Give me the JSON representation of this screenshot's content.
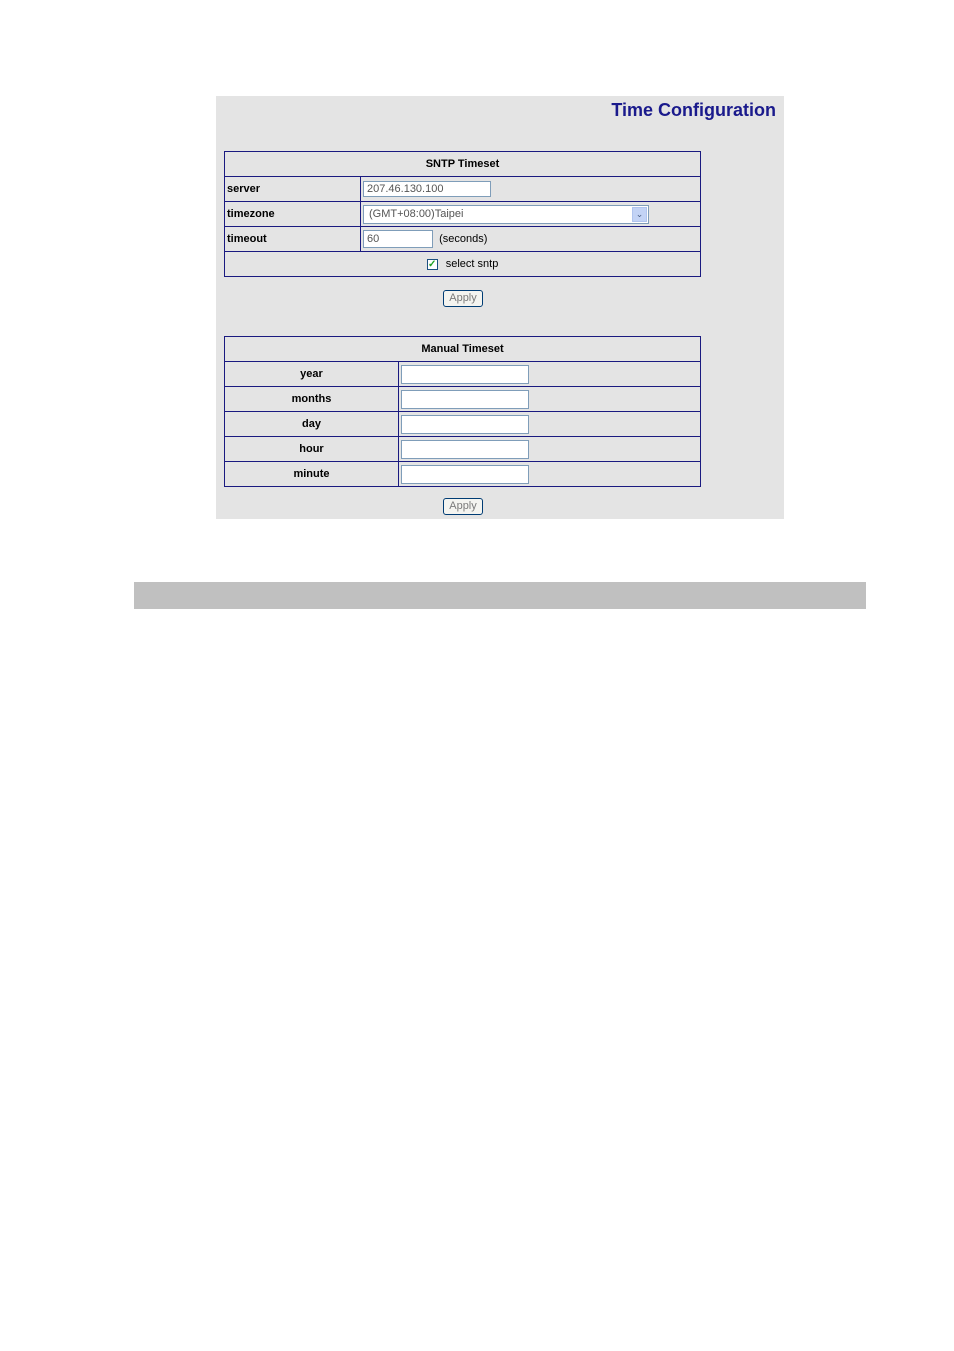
{
  "page": {
    "title": "Time Configuration"
  },
  "sntp": {
    "header": "SNTP Timeset",
    "server": {
      "label": "server",
      "value": "207.46.130.100"
    },
    "timezone": {
      "label": "timezone",
      "selected": "(GMT+08:00)Taipei"
    },
    "timeout": {
      "label": "timeout",
      "value": "60",
      "unit": "(seconds)"
    },
    "select_sntp": {
      "label": "select sntp",
      "checked": true
    },
    "apply_label": "Apply"
  },
  "manual": {
    "header": "Manual Timeset",
    "fields": [
      {
        "label": "year",
        "value": ""
      },
      {
        "label": "months",
        "value": ""
      },
      {
        "label": "day",
        "value": ""
      },
      {
        "label": "hour",
        "value": ""
      },
      {
        "label": "minute",
        "value": ""
      }
    ],
    "apply_label": "Apply"
  },
  "icons": {
    "dropdown_arrow": "chevron-down-icon",
    "checkmark": "checkmark-icon"
  },
  "colors": {
    "title": "#1a1a8c",
    "table_border": "#1a1a80",
    "panel_bg": "#e4e4e4",
    "footer_bar": "#c0c0c0"
  }
}
